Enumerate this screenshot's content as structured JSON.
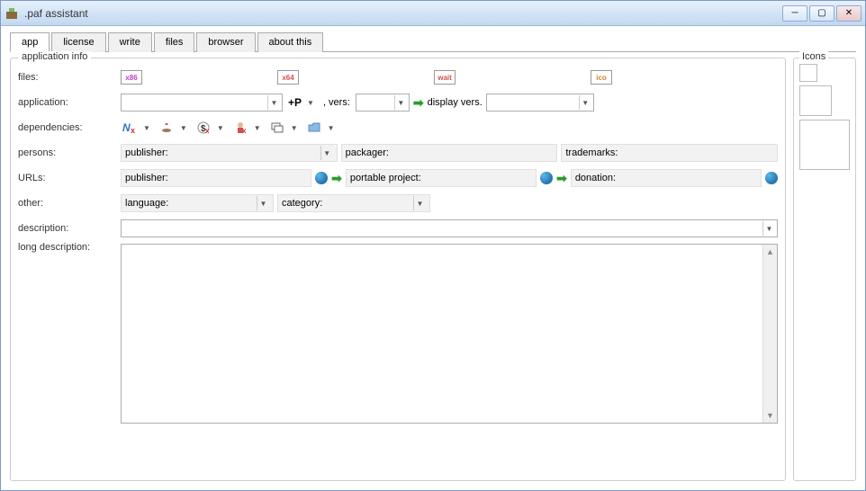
{
  "window": {
    "title": ".paf assistant"
  },
  "tabs": [
    "app",
    "license",
    "write",
    "files",
    "browser",
    "about this"
  ],
  "active_tab_index": 0,
  "fieldset_title": "application info",
  "labels": {
    "files": "files:",
    "application": "application:",
    "dependencies": "dependencies:",
    "persons": "persons:",
    "urls": "URLs:",
    "other": "other:",
    "description": "description:",
    "long_description": "long description:"
  },
  "file_icons": [
    "x86",
    "x64",
    "wait",
    "ico"
  ],
  "file_icon_colors": [
    "#c040c0",
    "#d05050",
    "#d05050",
    "#d08030"
  ],
  "app_row": {
    "plus_p": "+P",
    "vers_label": ", vers:",
    "display_vers": "display vers."
  },
  "persons_row": {
    "publisher": "publisher:",
    "packager": "packager:",
    "trademarks": "trademarks:"
  },
  "urls_row": {
    "publisher": "publisher:",
    "portable_project": "portable project:",
    "donation": "donation:"
  },
  "other_row": {
    "language": "language:",
    "category": "category:"
  },
  "icons_panel_title": "Icons",
  "dep_icons": [
    "nx-icon",
    "java-icon",
    "dollar-icon",
    "person-icon",
    "window-icon",
    "folder-icon"
  ]
}
